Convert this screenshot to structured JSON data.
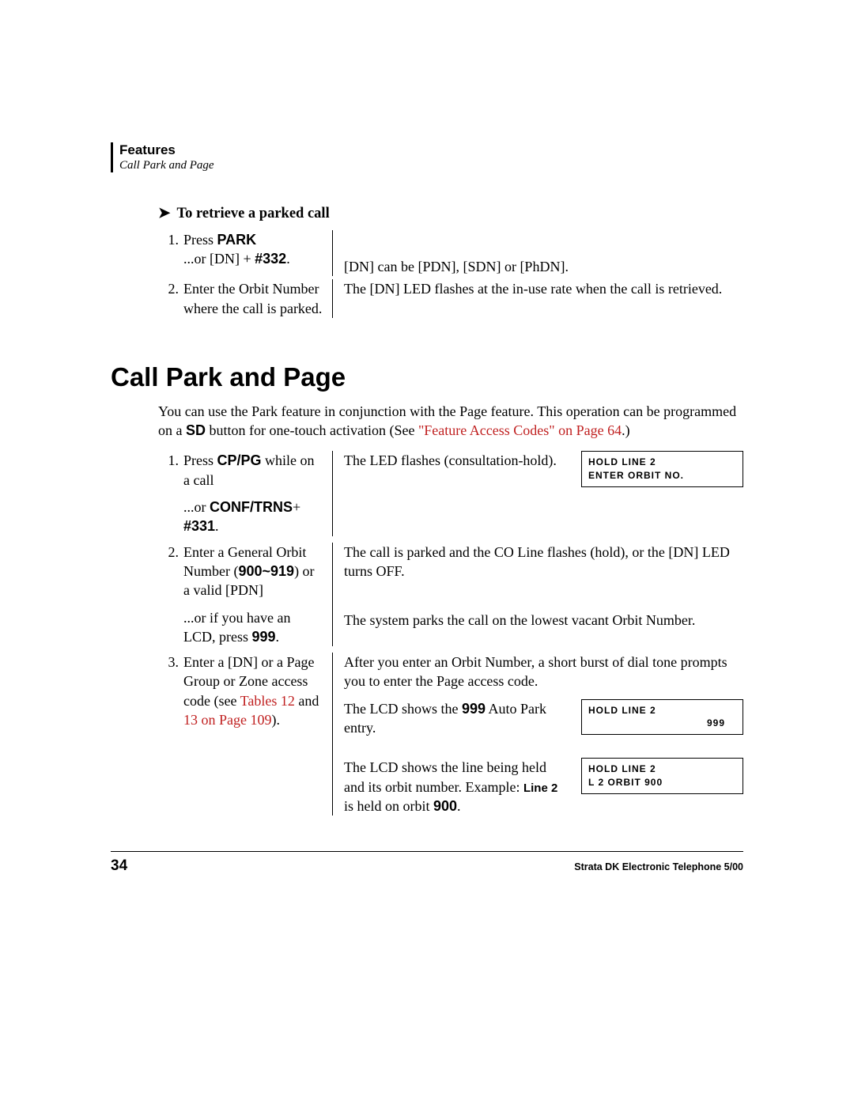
{
  "header": {
    "title": "Features",
    "subtitle": "Call Park and Page"
  },
  "proc1": {
    "title": "To retrieve a parked call",
    "steps": [
      {
        "n": "1.",
        "left_a": "Press ",
        "left_b": "PARK",
        "left_c": "...or [DN] + ",
        "left_d": "#332",
        "left_e": ".",
        "right": "[DN] can be [PDN], [SDN] or [PhDN]."
      },
      {
        "n": "2.",
        "left": "Enter the Orbit Number where the call is parked.",
        "right": "The [DN] LED flashes at the in-use rate when the call is retrieved."
      }
    ]
  },
  "section": {
    "heading": "Call Park and Page"
  },
  "intro": {
    "a": "You can use the Park feature in conjunction with the Page feature. This operation can be programmed on a ",
    "b": "SD",
    "c": " button for one-touch activation (See ",
    "link": "\"Feature Access Codes\" on Page 64",
    "d": ".)"
  },
  "steps2": {
    "s1": {
      "n": "1.",
      "l1a": "Press ",
      "l1b": "CP/PG",
      "l1c": " while on a call",
      "l2a": "...or ",
      "l2b": "CONF/TRNS",
      "l2c": "+ ",
      "l2d": "#331",
      "l2e": ".",
      "r1": "The LED flashes (consultation-hold)."
    },
    "s2": {
      "n": "2.",
      "l1a": "Enter a General Orbit Number (",
      "l1b": "900~919",
      "l1c": ") or a valid [PDN]",
      "l2a": "...or if you have an LCD, press ",
      "l2b": "999",
      "l2c": ".",
      "r1": "The call is parked and the CO Line flashes (hold), or the [DN] LED turns OFF.",
      "r2": "The system parks the call on the lowest vacant Orbit Number."
    },
    "s3": {
      "n": "3.",
      "l1a": "Enter a [DN] or a Page Group or Zone access code (see ",
      "link1": "Tables 12",
      "l1b": " and ",
      "link2": "13 on Page 109",
      "l1c": ").",
      "r1": "After you enter an Orbit Number, a short burst of dial tone prompts you to enter the Page access code.",
      "r2a": "The LCD shows the ",
      "r2b": "999",
      "r2c": " Auto Park entry.",
      "r3a": "The LCD shows the line being held and its orbit number. Example: ",
      "r3b": "Line 2",
      "r3c": " is held on orbit ",
      "r3d": "900",
      "r3e": "."
    }
  },
  "lcd": {
    "b1a": "HOLD LINE 2",
    "b1b": "ENTER ORBIT NO.",
    "b2a": "HOLD LINE 2",
    "b2b": "999",
    "b3a": "HOLD  LINE  2",
    "b3b": "L  2  ORBIT  900"
  },
  "footer": {
    "page": "34",
    "right": "Strata DK Electronic Telephone  5/00"
  }
}
